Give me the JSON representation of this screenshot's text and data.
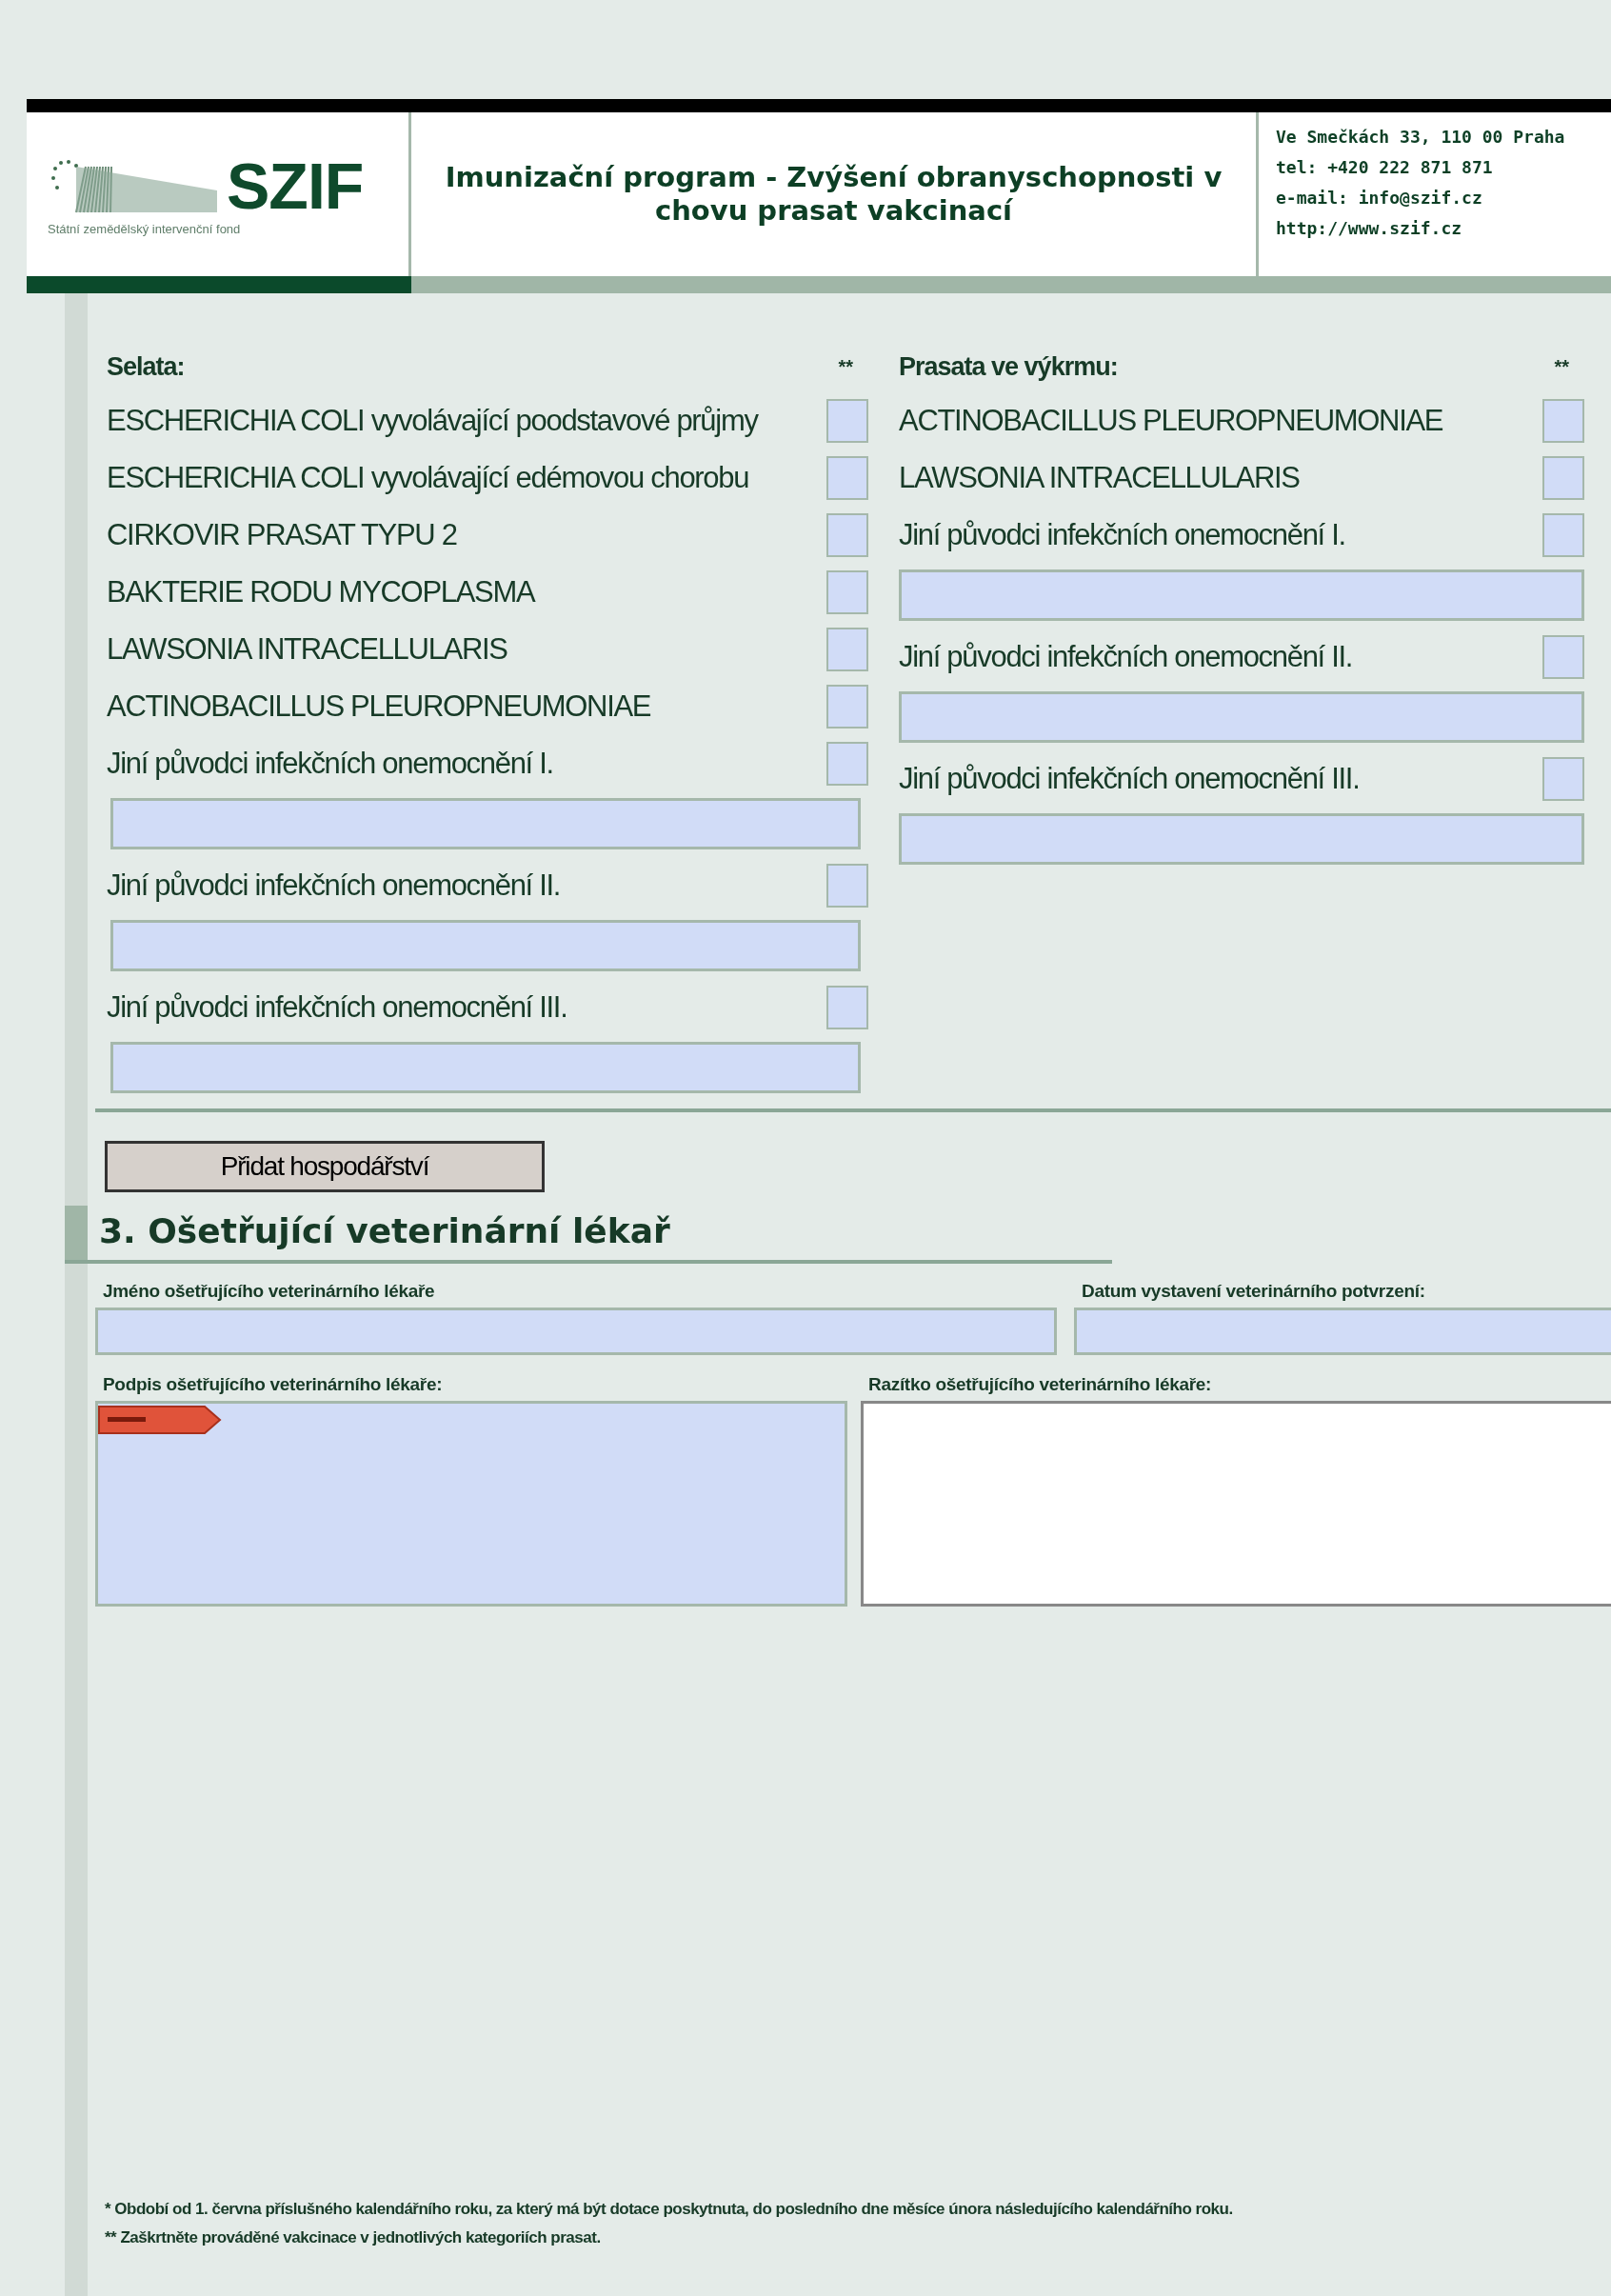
{
  "header": {
    "logo_text": "SZIF",
    "logo_subtitle": "Státní zemědělský intervenční fond",
    "title": "Imunizační program - Zvýšení obranyschopnosti v chovu prasat vakcinací",
    "contact": [
      "Ve Smečkách 33, 110 00 Praha",
      "tel: +420 222 871 871",
      "e-mail: info@szif.cz",
      "http://www.szif.cz"
    ]
  },
  "columns": [
    {
      "heading": "Selata:",
      "mark": "**",
      "items": [
        {
          "kind": "check",
          "label": "ESCHERICHIA COLI vyvolávající poodstavové průjmy",
          "checked": false
        },
        {
          "kind": "check",
          "label": "ESCHERICHIA COLI vyvolávající edémovou chorobu",
          "checked": false
        },
        {
          "kind": "check",
          "label": "CIRKOVIR PRASAT TYPU 2",
          "checked": false
        },
        {
          "kind": "check",
          "label": "BAKTERIE RODU MYCOPLASMA",
          "checked": false
        },
        {
          "kind": "check",
          "label": "LAWSONIA INTRACELLULARIS",
          "checked": false
        },
        {
          "kind": "check",
          "label": "ACTINOBACILLUS PLEUROPNEUMONIAE",
          "checked": false
        },
        {
          "kind": "check",
          "label": "Jiní původci infekčních onemocnění I.",
          "checked": false
        },
        {
          "kind": "field"
        },
        {
          "kind": "check",
          "label": "Jiní původci infekčních onemocnění II.",
          "checked": false
        },
        {
          "kind": "field"
        },
        {
          "kind": "check",
          "label": "Jiní původci infekčních onemocnění III.",
          "checked": false
        },
        {
          "kind": "field"
        }
      ]
    },
    {
      "heading": "Prasata ve výkrmu:",
      "mark": "**",
      "items": [
        {
          "kind": "check",
          "label": "ACTINOBACILLUS PLEUROPNEUMONIAE",
          "checked": false
        },
        {
          "kind": "check",
          "label": "LAWSONIA INTRACELLULARIS",
          "checked": false
        },
        {
          "kind": "check",
          "label": "Jiní původci infekčních onemocnění I.",
          "checked": false
        },
        {
          "kind": "field"
        },
        {
          "kind": "check",
          "label": "Jiní původci infekčních onemocnění II.",
          "checked": false
        },
        {
          "kind": "field"
        },
        {
          "kind": "check",
          "label": "Jiní původci infekčních onemocnění III.",
          "checked": false
        },
        {
          "kind": "field"
        }
      ]
    }
  ],
  "add_button": "Přidat hospodářství",
  "section": {
    "title": "3. Ošetřující veterinární lékař",
    "vet_name_label": "Jméno ošetřujícího veterinárního lékaře",
    "date_label": "Datum vystavení veterinárního potvrzení:",
    "signature_label": "Podpis ošetřujícího veterinárního lékaře:",
    "stamp_label": "Razítko ošetřujícího veterinárního lékaře:"
  },
  "footnotes": [
    "*   Období od 1. června příslušného kalendářního roku, za který má být dotace poskytnuta, do posledního dne měsíce února následujícího kalendářního roku.",
    "** Zaškrtněte prováděné vakcinace v jednotlivých kategoriích prasat."
  ]
}
